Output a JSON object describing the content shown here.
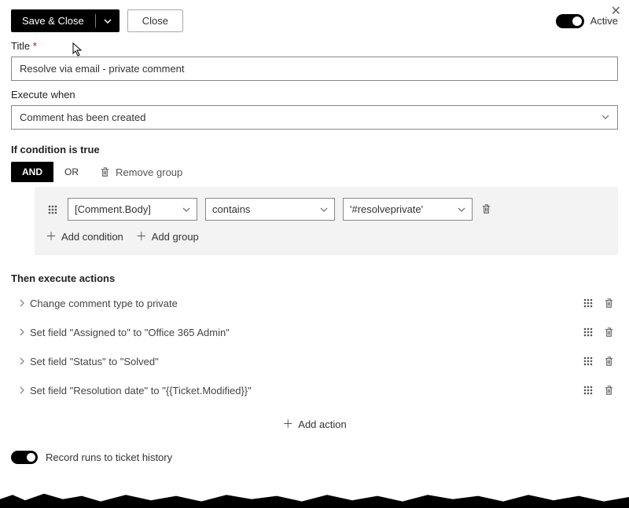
{
  "toolbar": {
    "save_close": "Save & Close",
    "close": "Close"
  },
  "status": {
    "label": "Active"
  },
  "title_section": {
    "label": "Title",
    "value": "Resolve via email - private comment"
  },
  "execute_when": {
    "label": "Execute when",
    "value": "Comment has been created"
  },
  "condition": {
    "header": "If condition is true",
    "tabs": {
      "and": "AND",
      "or": "OR"
    },
    "remove_group": "Remove group",
    "row": {
      "field": "[Comment.Body]",
      "operator": "contains",
      "value": "'#resolveprivate'"
    },
    "add_condition": "Add condition",
    "add_group": "Add group"
  },
  "actions": {
    "header": "Then execute actions",
    "items": [
      {
        "text": "Change comment type to private"
      },
      {
        "text": "Set field \"Assigned to\" to \"Office 365 Admin\""
      },
      {
        "text": "Set field \"Status\" to \"Solved\""
      },
      {
        "text": "Set field \"Resolution date\" to \"{{Ticket.Modified}}\""
      }
    ],
    "add_action": "Add action"
  },
  "footer": {
    "record_runs": "Record runs to ticket history"
  }
}
